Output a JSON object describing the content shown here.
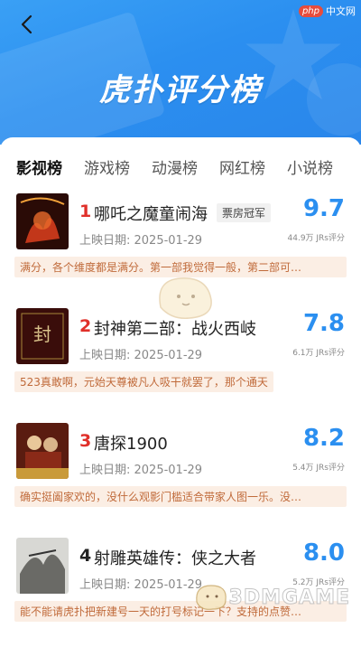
{
  "header": {
    "title": "虎扑评分榜",
    "title_small": "扑"
  },
  "tabs": [
    {
      "label": "影视榜",
      "active": true
    },
    {
      "label": "游戏榜",
      "active": false
    },
    {
      "label": "动漫榜",
      "active": false
    },
    {
      "label": "网红榜",
      "active": false
    },
    {
      "label": "小说榜",
      "active": false
    }
  ],
  "items": [
    {
      "rank": "1",
      "title": "哪吒之魔童闹海",
      "badge": "票房冠军",
      "date": "上映日期:  2025-01-29",
      "score": "9.7",
      "raters": "44.9万 JRs评分",
      "comment": "满分，各个维度都是满分。第一部我觉得一般，第二部可…",
      "rank_color": "#e0302a"
    },
    {
      "rank": "2",
      "title": "封神第二部：战火西岐",
      "badge": "",
      "date": "上映日期:  2025-01-29",
      "score": "7.8",
      "raters": "6.1万 JRs评分",
      "comment": "523真敢啊，元始天尊被凡人吸干就罢了，那个通天",
      "rank_color": "#e0302a"
    },
    {
      "rank": "3",
      "title": "唐探1900",
      "badge": "",
      "date": "上映日期:  2025-01-29",
      "score": "8.2",
      "raters": "5.4万 JRs评分",
      "comment": "确实挺阖家欢的，没什么观影门槛适合带家人图一乐。没…",
      "rank_color": "#e0302a"
    },
    {
      "rank": "4",
      "title": "射雕英雄传：侠之大者",
      "badge": "",
      "date": "上映日期:  2025-01-29",
      "score": "8.0",
      "raters": "5.2万 JRs评分",
      "comment": "能不能请虎扑把新建号一天的打号标记一下？支持的点赞…",
      "rank_color": "#222222"
    }
  ],
  "watermark": {
    "text": "3DMGAME"
  },
  "site_logo": {
    "p": "php",
    "t": "中文网"
  }
}
